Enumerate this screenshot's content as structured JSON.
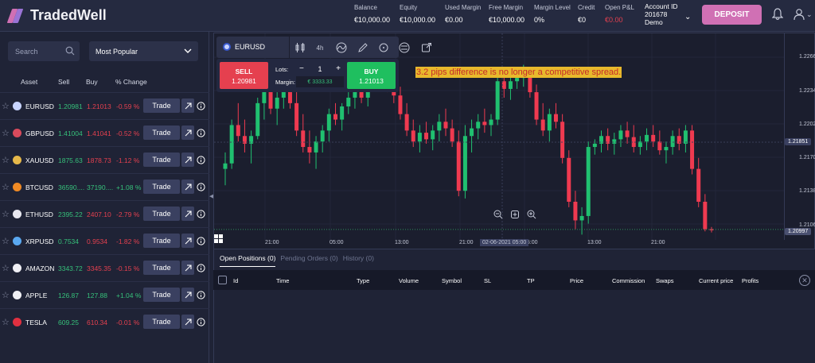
{
  "app": {
    "title": "TradedWell",
    "brand_colors": {
      "accent": "#d070b4",
      "sell": "#e5404f",
      "buy": "#1fbf5f",
      "positive": "#36c07a"
    }
  },
  "header": {
    "stats": [
      {
        "label": "Balance",
        "value": "€10,000.00"
      },
      {
        "label": "Equity",
        "value": "€10,000.00"
      },
      {
        "label": "Used Margin",
        "value": "€0.00"
      },
      {
        "label": "Free Margin",
        "value": "€10,000.00"
      },
      {
        "label": "Margin Level",
        "value": "0%"
      },
      {
        "label": "Credit",
        "value": "€0"
      },
      {
        "label": "Open P&L",
        "value": "€0.00"
      }
    ],
    "account": {
      "label": "Account ID",
      "id": "201678",
      "type": "Demo"
    },
    "deposit_label": "DEPOSIT",
    "icons": {
      "bell": "bell-icon",
      "user": "user-icon"
    }
  },
  "sidebar": {
    "search_placeholder": "Search",
    "filter_selected": "Most Popular",
    "columns": [
      "Asset",
      "Sell",
      "Buy",
      "% Change"
    ],
    "trade_label": "Trade",
    "assets": [
      {
        "name": "EURUSD",
        "sell": "1.20981",
        "buy": "1.21013",
        "change": "-0.59 %",
        "icon_color": "#c8d4ff",
        "up": false
      },
      {
        "name": "GBPUSD",
        "sell": "1.41004",
        "buy": "1.41041",
        "change": "-0.52 %",
        "icon_color": "#d94a5c",
        "up": false
      },
      {
        "name": "XAUUSD",
        "sell": "1875.63",
        "buy": "1878.73",
        "change": "-1.12 %",
        "icon_color": "#e6b84a",
        "up": false
      },
      {
        "name": "BTCUSD",
        "sell": "36590....",
        "buy": "37190....",
        "change": "+1.08 %",
        "icon_color": "#f08a24",
        "up": true
      },
      {
        "name": "ETHUSD",
        "sell": "2395.22",
        "buy": "2407.10",
        "change": "-2.79 %",
        "icon_color": "#e8e8f0",
        "up": false
      },
      {
        "name": "XRPUSD",
        "sell": "0.7534",
        "buy": "0.9534",
        "change": "-1.82 %",
        "icon_color": "#5aa8f0",
        "up": false
      },
      {
        "name": "AMAZON",
        "sell": "3343.72",
        "buy": "3345.35",
        "change": "-0.15 %",
        "icon_color": "#f0f0f5",
        "up": false
      },
      {
        "name": "APPLE",
        "sell": "126.87",
        "buy": "127.88",
        "change": "+1.04 %",
        "icon_color": "#f0f0f5",
        "up": true
      },
      {
        "name": "TESLA",
        "sell": "609.25",
        "buy": "610.34",
        "change": "-0.01 %",
        "icon_color": "#e03040",
        "up": false
      }
    ]
  },
  "chart": {
    "symbol": "EURUSD",
    "timeframe": "4h",
    "sell": {
      "label": "SELL",
      "price": "1.20981"
    },
    "buy": {
      "label": "BUY",
      "price": "1.21013"
    },
    "lots_label": "Lots:",
    "lots_value": "1",
    "margin_label": "Margin:",
    "margin_value": "€ 3333.33",
    "annotation": "3.2 pips difference is no longer a competitive spread.",
    "y_ticks": [
      "1.22660",
      "1.22340",
      "1.22020",
      "1.21700",
      "1.21380",
      "1.21060"
    ],
    "y_tags": [
      "1.21851",
      "1.20997"
    ],
    "x_ticks": [
      "21:00",
      "05:00",
      "13:00",
      "21:00",
      "05:00",
      "13:00",
      "21:00"
    ],
    "x_tag": "02-06-2021 05:00"
  },
  "chart_data": {
    "type": "candlestick",
    "symbol": "EURUSD",
    "ylim": [
      1.2096,
      1.227
    ],
    "candles": [
      [
        1.2155,
        1.217,
        1.214,
        1.216
      ],
      [
        1.216,
        1.22,
        1.2155,
        1.2195
      ],
      [
        1.2195,
        1.2215,
        1.218,
        1.2185
      ],
      [
        1.2185,
        1.22,
        1.217,
        1.2178
      ],
      [
        1.2178,
        1.219,
        1.216,
        1.2185
      ],
      [
        1.2185,
        1.222,
        1.2182,
        1.2215
      ],
      [
        1.2215,
        1.2235,
        1.22,
        1.223
      ],
      [
        1.223,
        1.224,
        1.2205,
        1.221
      ],
      [
        1.221,
        1.2225,
        1.2195,
        1.222
      ],
      [
        1.222,
        1.224,
        1.221,
        1.223
      ],
      [
        1.223,
        1.2235,
        1.221,
        1.2215
      ],
      [
        1.2215,
        1.2225,
        1.2185,
        1.219
      ],
      [
        1.219,
        1.2205,
        1.217,
        1.2175
      ],
      [
        1.2175,
        1.219,
        1.216,
        1.217
      ],
      [
        1.217,
        1.2185,
        1.2155,
        1.218
      ],
      [
        1.218,
        1.2195,
        1.217,
        1.219
      ],
      [
        1.219,
        1.221,
        1.218,
        1.2205
      ],
      [
        1.2205,
        1.2215,
        1.2195,
        1.22
      ],
      [
        1.22,
        1.2215,
        1.219,
        1.2212
      ],
      [
        1.2212,
        1.2225,
        1.2205,
        1.222
      ],
      [
        1.222,
        1.2232,
        1.221,
        1.2228
      ],
      [
        1.2228,
        1.2238,
        1.2215,
        1.222
      ],
      [
        1.222,
        1.224,
        1.2212,
        1.2236
      ],
      [
        1.2236,
        1.2248,
        1.2228,
        1.2245
      ],
      [
        1.2245,
        1.225,
        1.2232,
        1.224
      ],
      [
        1.224,
        1.225,
        1.2225,
        1.2232
      ],
      [
        1.2232,
        1.224,
        1.2215,
        1.2222
      ],
      [
        1.2222,
        1.223,
        1.22,
        1.2205
      ],
      [
        1.2205,
        1.2215,
        1.2185,
        1.219
      ],
      [
        1.219,
        1.22,
        1.2175,
        1.218
      ],
      [
        1.218,
        1.2195,
        1.217,
        1.2188
      ],
      [
        1.2188,
        1.2198,
        1.2178,
        1.2182
      ],
      [
        1.2182,
        1.2195,
        1.2172,
        1.219
      ],
      [
        1.219,
        1.2205,
        1.218,
        1.2198
      ],
      [
        1.2198,
        1.221,
        1.2185,
        1.2192
      ],
      [
        1.2192,
        1.22,
        1.2175,
        1.218
      ],
      [
        1.218,
        1.219,
        1.213,
        1.2135
      ],
      [
        1.2135,
        1.2195,
        1.2128,
        1.2185
      ],
      [
        1.2185,
        1.22,
        1.217,
        1.2192
      ],
      [
        1.2192,
        1.2205,
        1.2182,
        1.2198
      ],
      [
        1.2198,
        1.221,
        1.2188,
        1.2195
      ],
      [
        1.2195,
        1.2205,
        1.2185,
        1.22
      ],
      [
        1.22,
        1.224,
        1.2195,
        1.2235
      ],
      [
        1.2235,
        1.2245,
        1.222,
        1.2228
      ],
      [
        1.2228,
        1.224,
        1.2218,
        1.2235
      ],
      [
        1.2235,
        1.2245,
        1.2228,
        1.2238
      ],
      [
        1.2238,
        1.225,
        1.223,
        1.224
      ],
      [
        1.224,
        1.2248,
        1.222,
        1.2225
      ],
      [
        1.2225,
        1.2232,
        1.2195,
        1.22
      ],
      [
        1.22,
        1.2215,
        1.2185,
        1.219
      ],
      [
        1.219,
        1.221,
        1.218,
        1.2205
      ],
      [
        1.2205,
        1.2215,
        1.2192,
        1.2198
      ],
      [
        1.2198,
        1.2205,
        1.216,
        1.2165
      ],
      [
        1.2165,
        1.2172,
        1.212,
        1.2125
      ],
      [
        1.2125,
        1.2135,
        1.21,
        1.2108
      ],
      [
        1.2108,
        1.212,
        1.2095,
        1.2112
      ],
      [
        1.2112,
        1.218,
        1.2105,
        1.2175
      ],
      [
        1.2175,
        1.2182,
        1.2168,
        1.2178
      ],
      [
        1.2178,
        1.219,
        1.217,
        1.2185
      ],
      [
        1.2185,
        1.2192,
        1.2172,
        1.2178
      ],
      [
        1.2178,
        1.2188,
        1.2168,
        1.2182
      ],
      [
        1.2182,
        1.2195,
        1.2175,
        1.219
      ],
      [
        1.219,
        1.2198,
        1.2178,
        1.2184
      ],
      [
        1.2184,
        1.2195,
        1.217,
        1.2175
      ],
      [
        1.2175,
        1.2185,
        1.2168,
        1.218
      ],
      [
        1.218,
        1.2192,
        1.2172,
        1.2186
      ],
      [
        1.2186,
        1.2195,
        1.2175,
        1.218
      ],
      [
        1.218,
        1.219,
        1.2168,
        1.2172
      ],
      [
        1.2172,
        1.218,
        1.216,
        1.2175
      ],
      [
        1.2175,
        1.219,
        1.2168,
        1.2185
      ],
      [
        1.2185,
        1.2192,
        1.2172,
        1.2178
      ],
      [
        1.2178,
        1.2195,
        1.217,
        1.219
      ],
      [
        1.219,
        1.2195,
        1.215,
        1.2155
      ],
      [
        1.2155,
        1.2165,
        1.212,
        1.2125
      ],
      [
        1.2125,
        1.2132,
        1.2098,
        1.21
      ],
      [
        1.21,
        1.2102,
        1.2097,
        1.2099
      ]
    ],
    "current_price": 1.20997,
    "x_ticks": [
      "21:00",
      "05:00",
      "13:00",
      "21:00",
      "05:00",
      "13:00",
      "21:00"
    ]
  },
  "bottom": {
    "tabs": [
      "Open Positions (0)",
      "Pending Orders (0)",
      "History (0)"
    ],
    "columns": [
      "Id",
      "Time",
      "Type",
      "Volume",
      "Symbol",
      "SL",
      "TP",
      "Price",
      "Commission",
      "Swaps",
      "Current price",
      "Profits"
    ]
  }
}
